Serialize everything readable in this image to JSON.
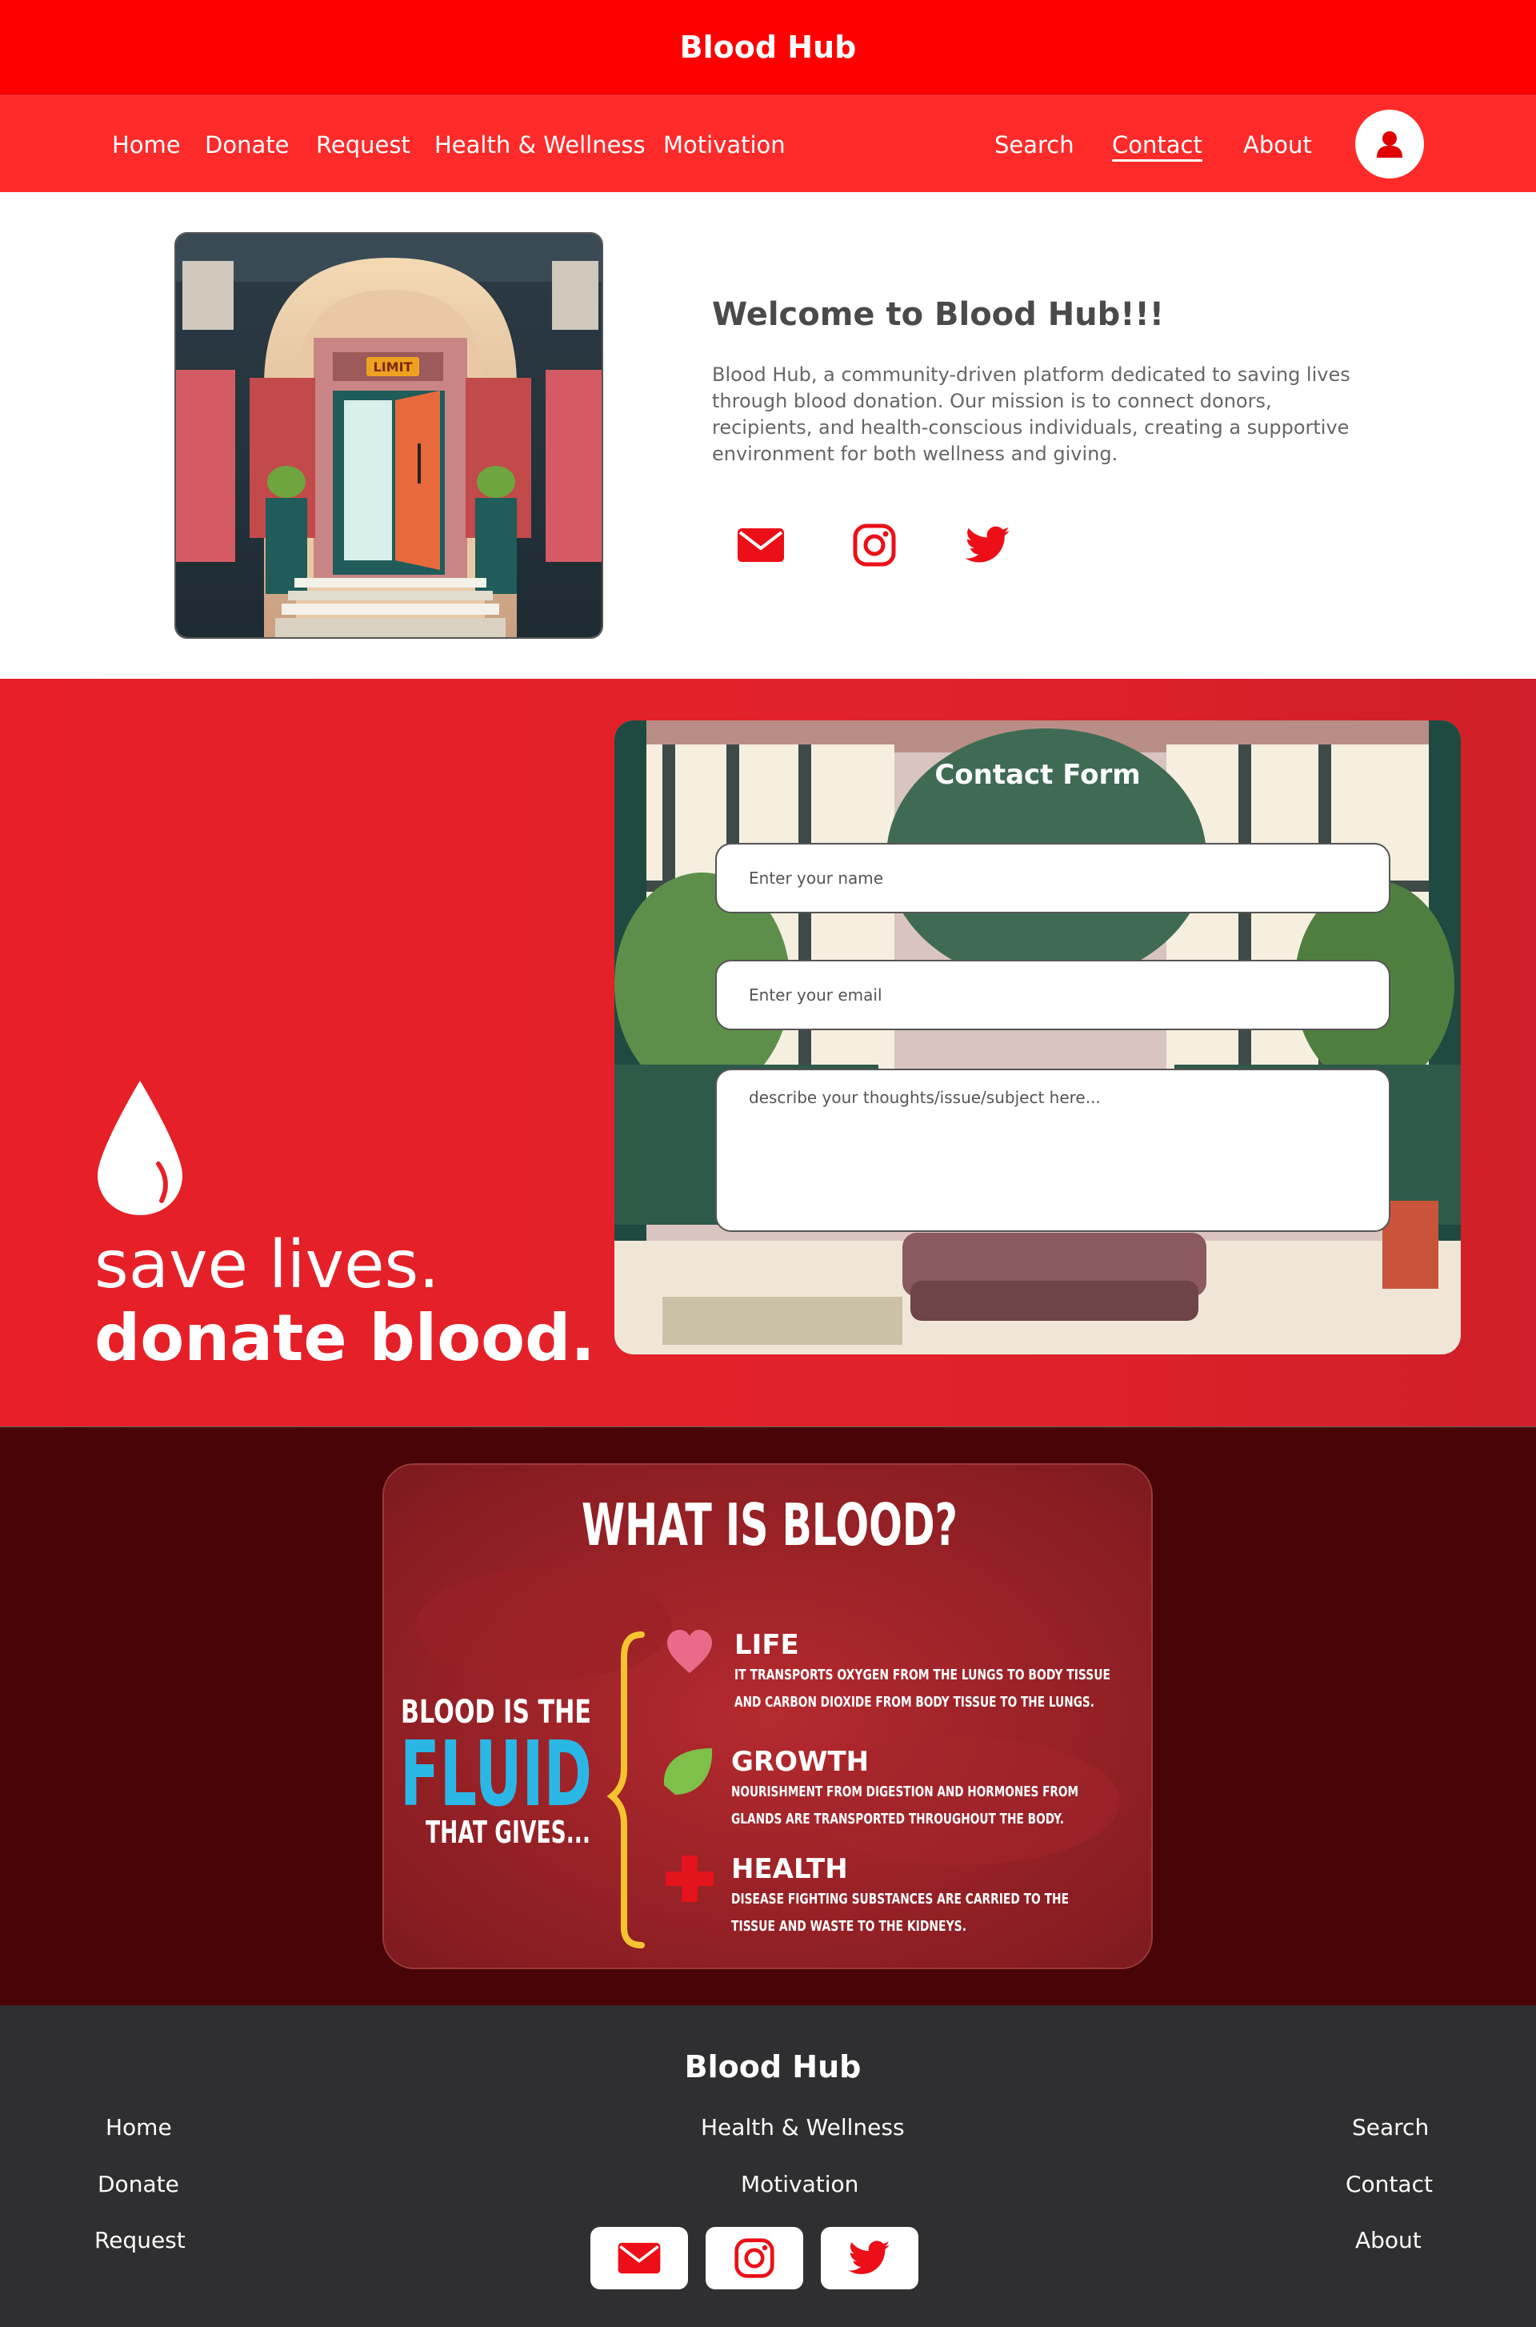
{
  "header": {
    "title": "Blood Hub"
  },
  "nav": {
    "left": [
      "Home",
      "Donate",
      "Request",
      "Health & Wellness",
      "Motivation"
    ],
    "right": [
      "Search",
      "Contact",
      "About"
    ],
    "active": "Contact",
    "profile_icon": "user-icon"
  },
  "welcome": {
    "title": "Welcome to Blood Hub!!!",
    "text": "Blood Hub, a community-driven platform dedicated to saving lives through blood donation. Our mission is to connect donors, recipients, and health-conscious individuals, creating a supportive environment for both wellness and giving.",
    "image_sign": "LIMIT",
    "socials": [
      "mail-icon",
      "instagram-icon",
      "twitter-icon"
    ]
  },
  "hero": {
    "slogan_line1": "save lives.",
    "slogan_line2": "donate blood."
  },
  "contact": {
    "title": "Contact Form",
    "name_placeholder": "Enter your name",
    "email_placeholder": "Enter your email",
    "message_placeholder": "describe your thoughts/issue/subject here..."
  },
  "infographic": {
    "title": "WHAT IS BLOOD?",
    "left_line1": "BLOOD IS THE",
    "left_line2": "FLUID",
    "left_line3": "THAT GIVES...",
    "items": [
      {
        "heading": "LIFE",
        "line1": "IT TRANSPORTS OXYGEN FROM THE LUNGS TO BODY TISSUE",
        "line2": "AND CARBON DIOXIDE FROM BODY TISSUE TO THE LUNGS."
      },
      {
        "heading": "GROWTH",
        "line1": "NOURISHMENT FROM DIGESTION AND HORMONES FROM",
        "line2": "GLANDS ARE TRANSPORTED THROUGHOUT THE BODY."
      },
      {
        "heading": "HEALTH",
        "line1": "DISEASE FIGHTING SUBSTANCES ARE CARRIED TO THE",
        "line2": "TISSUE AND WASTE TO THE KIDNEYS."
      }
    ]
  },
  "footer": {
    "title": "Blood Hub",
    "col_left": [
      "Home",
      "Donate",
      "Request"
    ],
    "col_mid": [
      "Health & Wellness",
      "Motivation"
    ],
    "col_right": [
      "Search",
      "Contact",
      "About"
    ],
    "socials": [
      "mail-icon",
      "instagram-icon",
      "twitter-icon"
    ]
  },
  "colors": {
    "brand": "#ff0000",
    "nav": "#ff2a2a",
    "hero": "#e81f27",
    "info_bg": "#480407",
    "footer": "#2f2e30"
  }
}
